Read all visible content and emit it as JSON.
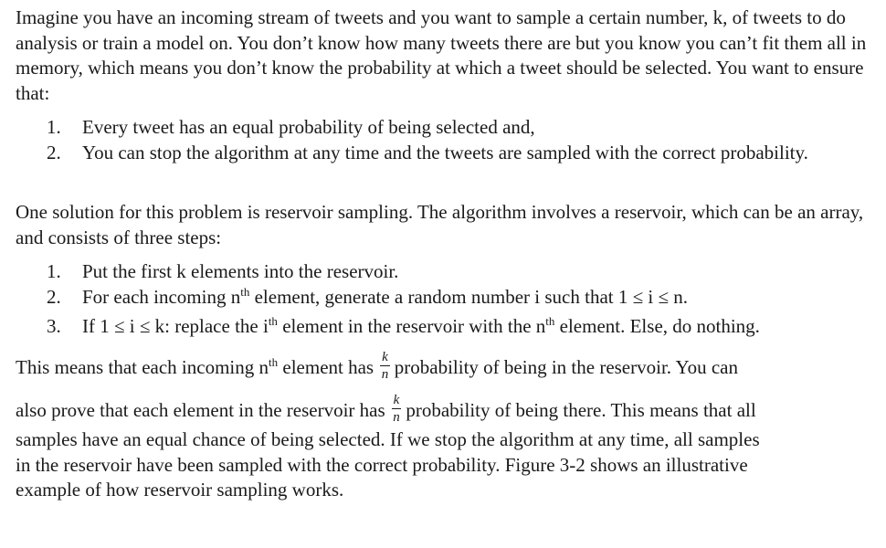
{
  "paragraph1": "Imagine you have an incoming stream of tweets and you want to sample a certain number, k, of tweets to do analysis or train a model on. You don’t know how many tweets there are but you know you can’t fit them all in memory, which means you don’t know the probability at which a tweet should be selected. You want to ensure that:",
  "list1": [
    {
      "num": "1.",
      "text": "Every tweet has an equal probability of being selected and,"
    },
    {
      "num": "2.",
      "text": "You can stop the algorithm at any time and the tweets are sampled with the correct probability."
    }
  ],
  "paragraph2": "One solution for this problem is reservoir sampling. The algorithm involves a reservoir, which can be an array, and consists of three steps:",
  "list2": {
    "item1": {
      "num": "1.",
      "text": "Put the first k elements into the reservoir."
    },
    "item2": {
      "num": "2.",
      "pre": "For each incoming n",
      "sup": "th",
      "post": " element, generate a random number i such that 1 ≤ i ≤ n."
    },
    "item3": {
      "num": "3.",
      "pre": "If 1 ≤ i ≤ k: replace the i",
      "sup1": "th",
      "mid": " element in the reservoir with the n",
      "sup2": "th",
      "post": " element. Else, do nothing."
    }
  },
  "paragraph3": {
    "l1_pre": "This means that each incoming n",
    "l1_sup": "th",
    "l1_mid": " element has",
    "frac_num": "k",
    "frac_den": "n",
    "l1_post": "probability of being in the reservoir. You can",
    "l2_pre": "also prove that each element in the reservoir has",
    "l2_post": "probability of being there. This means that all",
    "l3": "samples have an equal chance of being selected. If we stop the algorithm at any time, all samples",
    "l4": "in the reservoir have been sampled with the correct probability. Figure 3-2 shows an illustrative",
    "l5": "example of how reservoir sampling works."
  }
}
